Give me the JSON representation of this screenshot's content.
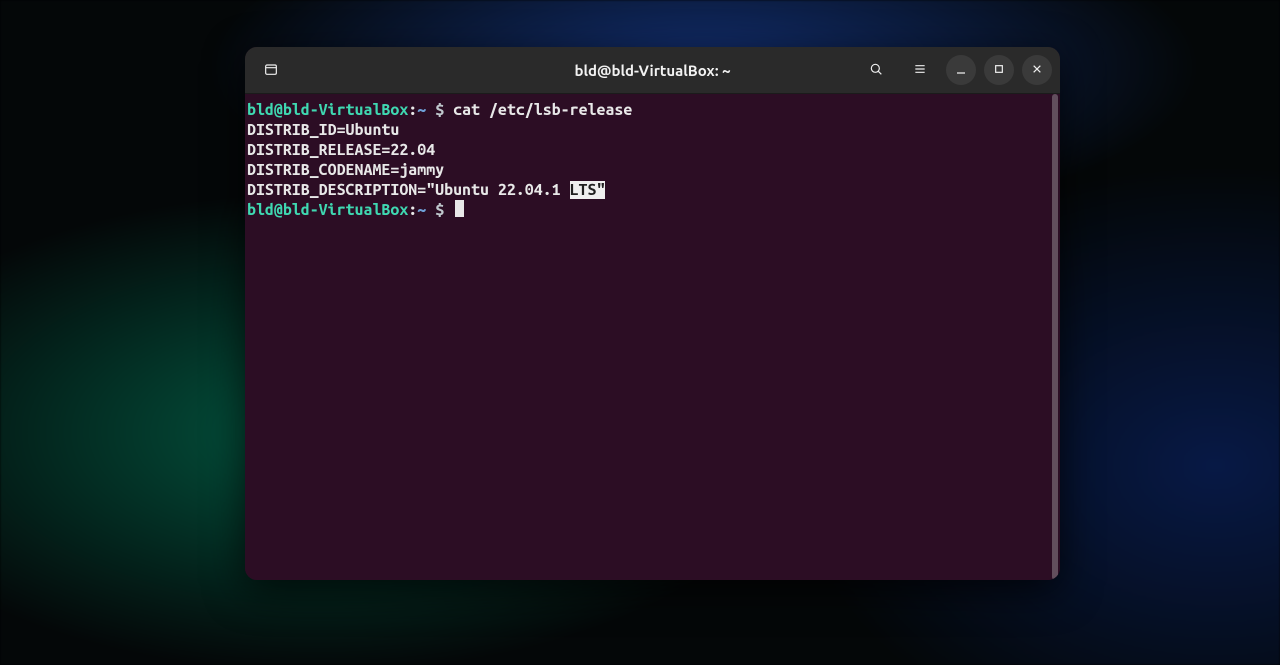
{
  "window": {
    "title": "bld@bld-VirtualBox: ~"
  },
  "prompt": {
    "user_host": "bld@bld-VirtualBox",
    "separator": ":",
    "path": "~",
    "symbol": "$"
  },
  "terminal": {
    "command": "cat /etc/lsb-release",
    "output": {
      "line1": "DISTRIB_ID=Ubuntu",
      "line2": "DISTRIB_RELEASE=22.04",
      "line3": "DISTRIB_CODENAME=jammy",
      "line4_pre": "DISTRIB_DESCRIPTION=\"Ubuntu 22.04.1 ",
      "line4_sel": "LTS\"",
      "full_description": "DISTRIB_DESCRIPTION=\"Ubuntu 22.04.1 LTS\""
    }
  },
  "icons": {
    "newtab": "new-tab-icon",
    "search": "search-icon",
    "menu": "hamburger-menu-icon",
    "minimize": "minimize-icon",
    "maximize": "maximize-icon",
    "close": "close-icon"
  }
}
